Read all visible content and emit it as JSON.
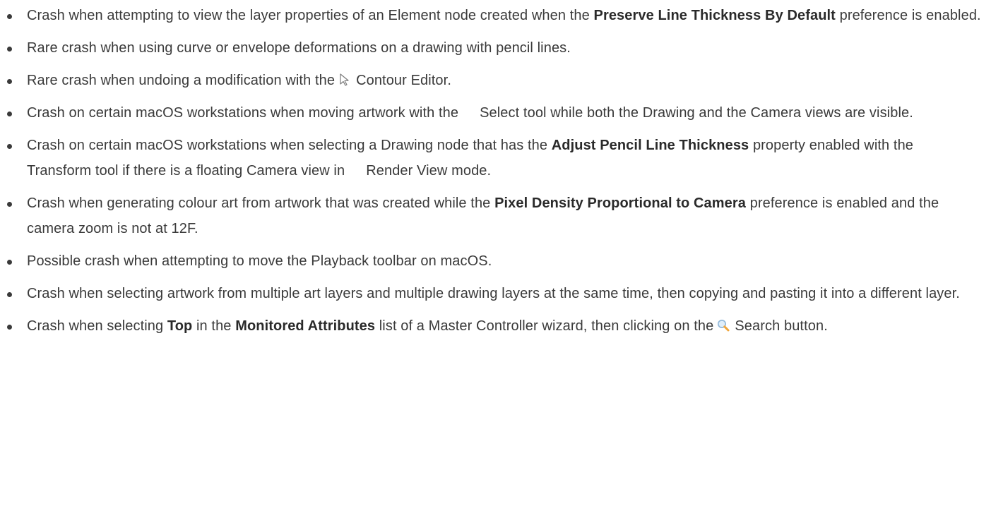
{
  "items": [
    {
      "t1": "Crash when attempting to view the layer properties of an Element node created when the ",
      "b1": "Preserve Line Thickness By Default",
      "t2": " preference is enabled."
    },
    {
      "t1": "Rare crash when using curve or envelope deformations on a drawing with pencil lines."
    },
    {
      "t1": "Rare crash when undoing a modification with the",
      "icon": "contour-editor-arrow-icon",
      "t2": "Contour Editor."
    },
    {
      "t1": "Crash on certain macOS workstations when moving artwork with the",
      "icon": "select-tool-icon",
      "t2": "Select tool while both the Drawing and the Camera views are visible."
    },
    {
      "t1": "Crash on certain macOS workstations when selecting a Drawing node that has the ",
      "b1": "Adjust Pencil Line Thickness",
      "t2": " property enabled with the",
      "icon1": "transform-tool-icon",
      "t3": "Transform tool if there is a floating Camera view in",
      "icon2": "render-view-icon",
      "t4": "Render View mode."
    },
    {
      "t1": "Crash when generating colour art from artwork that was created while the ",
      "b1": "Pixel Density Proportional to Camera",
      "t2": " preference is enabled and the camera zoom is not at 12F."
    },
    {
      "t1": "Possible crash when attempting to move the Playback toolbar on macOS."
    },
    {
      "t1": "Crash when selecting artwork from multiple art layers and multiple drawing layers at the same time, then copying and pasting it into a different layer."
    },
    {
      "t1": "Crash when selecting ",
      "b1": "Top",
      "t2": " in the ",
      "b2": "Monitored Attributes",
      "t3": " list of a Master Controller wizard, then clicking on the",
      "icon": "search-magnifier-icon",
      "t4": "Search button."
    }
  ]
}
